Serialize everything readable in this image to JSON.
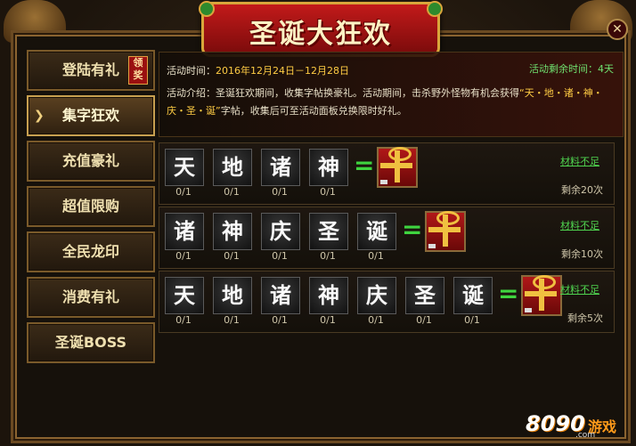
{
  "window": {
    "title": "圣诞大狂欢",
    "close_label": "✕"
  },
  "sidebar": {
    "items": [
      {
        "label": "登陆有礼",
        "badge": "领奖"
      },
      {
        "label": "集字狂欢"
      },
      {
        "label": "充值豪礼"
      },
      {
        "label": "超值限购"
      },
      {
        "label": "全民龙印"
      },
      {
        "label": "消费有礼"
      },
      {
        "label": "圣诞BOSS"
      }
    ],
    "active_index": 1
  },
  "info": {
    "time_label": "活动时间：",
    "time_value": "2016年12月24日－12月28日",
    "remain_label": "活动剩余时间：",
    "remain_value": "4天",
    "desc_label": "活动介绍：",
    "desc_part1": "圣诞狂欢期间，收集字帖换豪礼。活动期间，击杀野外怪物有机会获得",
    "desc_highlight": "“天・地・诸・神・庆・圣・诞”",
    "desc_part2": "字帖，收集后可至活动面板兑换限时好礼。"
  },
  "rows": [
    {
      "chars": [
        "天",
        "地",
        "诸",
        "神"
      ],
      "counts": [
        "0/1",
        "0/1",
        "0/1",
        "0/1"
      ],
      "status": "材料不足",
      "remaining": "剩余20次"
    },
    {
      "chars": [
        "诸",
        "神",
        "庆",
        "圣",
        "诞"
      ],
      "counts": [
        "0/1",
        "0/1",
        "0/1",
        "0/1",
        "0/1"
      ],
      "status": "材料不足",
      "remaining": "剩余10次"
    },
    {
      "chars": [
        "天",
        "地",
        "诸",
        "神",
        "庆",
        "圣",
        "诞"
      ],
      "counts": [
        "0/1",
        "0/1",
        "0/1",
        "0/1",
        "0/1",
        "0/1",
        "0/1"
      ],
      "status": "材料不足",
      "remaining": "剩余5次"
    }
  ],
  "equals_sign": "=",
  "logo": {
    "number": "8090",
    "text": "游戏",
    "url": ".com"
  },
  "colors": {
    "accent_green": "#4fd44f",
    "highlight_yellow": "#ffcc44",
    "banner_red": "#c21a1a"
  }
}
